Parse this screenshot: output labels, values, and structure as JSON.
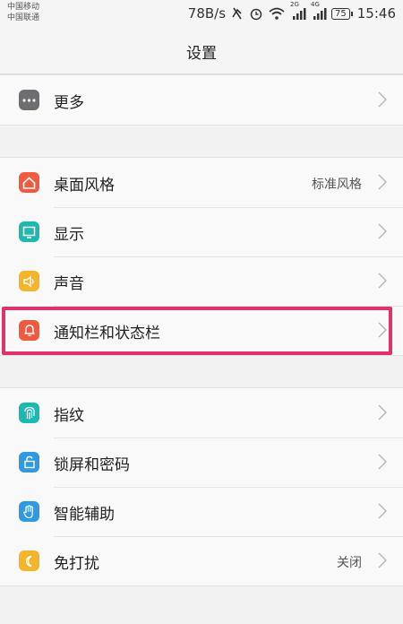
{
  "status_bar": {
    "carrier_1": "中国移动",
    "carrier_2": "中国联通",
    "speed": "78B/s",
    "net_1": "2G",
    "net_2": "4G",
    "battery": "75",
    "time": "15:46"
  },
  "header": {
    "title": "设置"
  },
  "groups": [
    {
      "items": [
        {
          "label": "更多",
          "value": "",
          "icon": "more-icon",
          "color": "#6d6d72"
        }
      ]
    },
    {
      "items": [
        {
          "label": "桌面风格",
          "value": "标准风格",
          "icon": "home-icon",
          "color": "#f05b3f"
        },
        {
          "label": "显示",
          "value": "",
          "icon": "display-icon",
          "color": "#1bb9b0"
        },
        {
          "label": "声音",
          "value": "",
          "icon": "sound-icon",
          "color": "#f5b52a"
        },
        {
          "label": "通知栏和状态栏",
          "value": "",
          "icon": "bell-icon",
          "color": "#f05b3f"
        }
      ]
    },
    {
      "items": [
        {
          "label": "指纹",
          "value": "",
          "icon": "fingerprint-icon",
          "color": "#1bb9b0"
        },
        {
          "label": "锁屏和密码",
          "value": "",
          "icon": "lock-icon",
          "color": "#2f9ae0"
        },
        {
          "label": "智能辅助",
          "value": "",
          "icon": "hand-icon",
          "color": "#2f9ae0"
        },
        {
          "label": "免打扰",
          "value": "关闭",
          "icon": "moon-icon",
          "color": "#f5b52a"
        }
      ]
    }
  ],
  "highlight_color": "#e0306e"
}
